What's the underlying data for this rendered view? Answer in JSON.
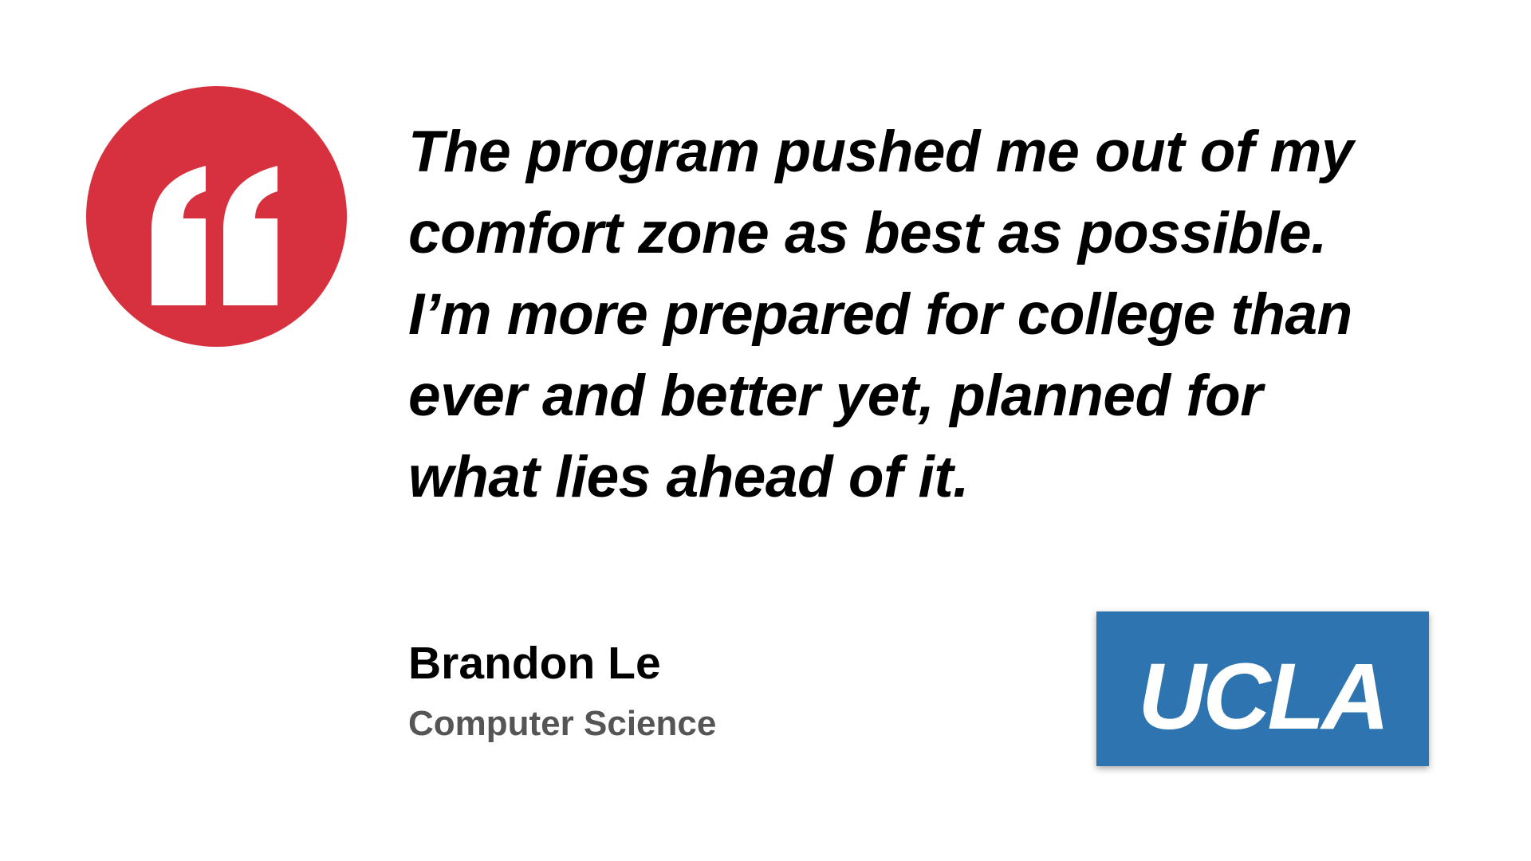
{
  "testimonial": {
    "quote_lines": [
      "The program pushed me out of my",
      "comfort zone as best as possible.",
      "I’m more prepared for college than",
      "ever and better yet, planned for",
      "what lies ahead of it."
    ],
    "author": "Brandon Le",
    "field": "Computer Science"
  },
  "logo": {
    "text": "UCLA",
    "background_color": "#2e74b0"
  },
  "quote_icon": {
    "name": "quote-mark-icon",
    "color": "#d7313f"
  }
}
